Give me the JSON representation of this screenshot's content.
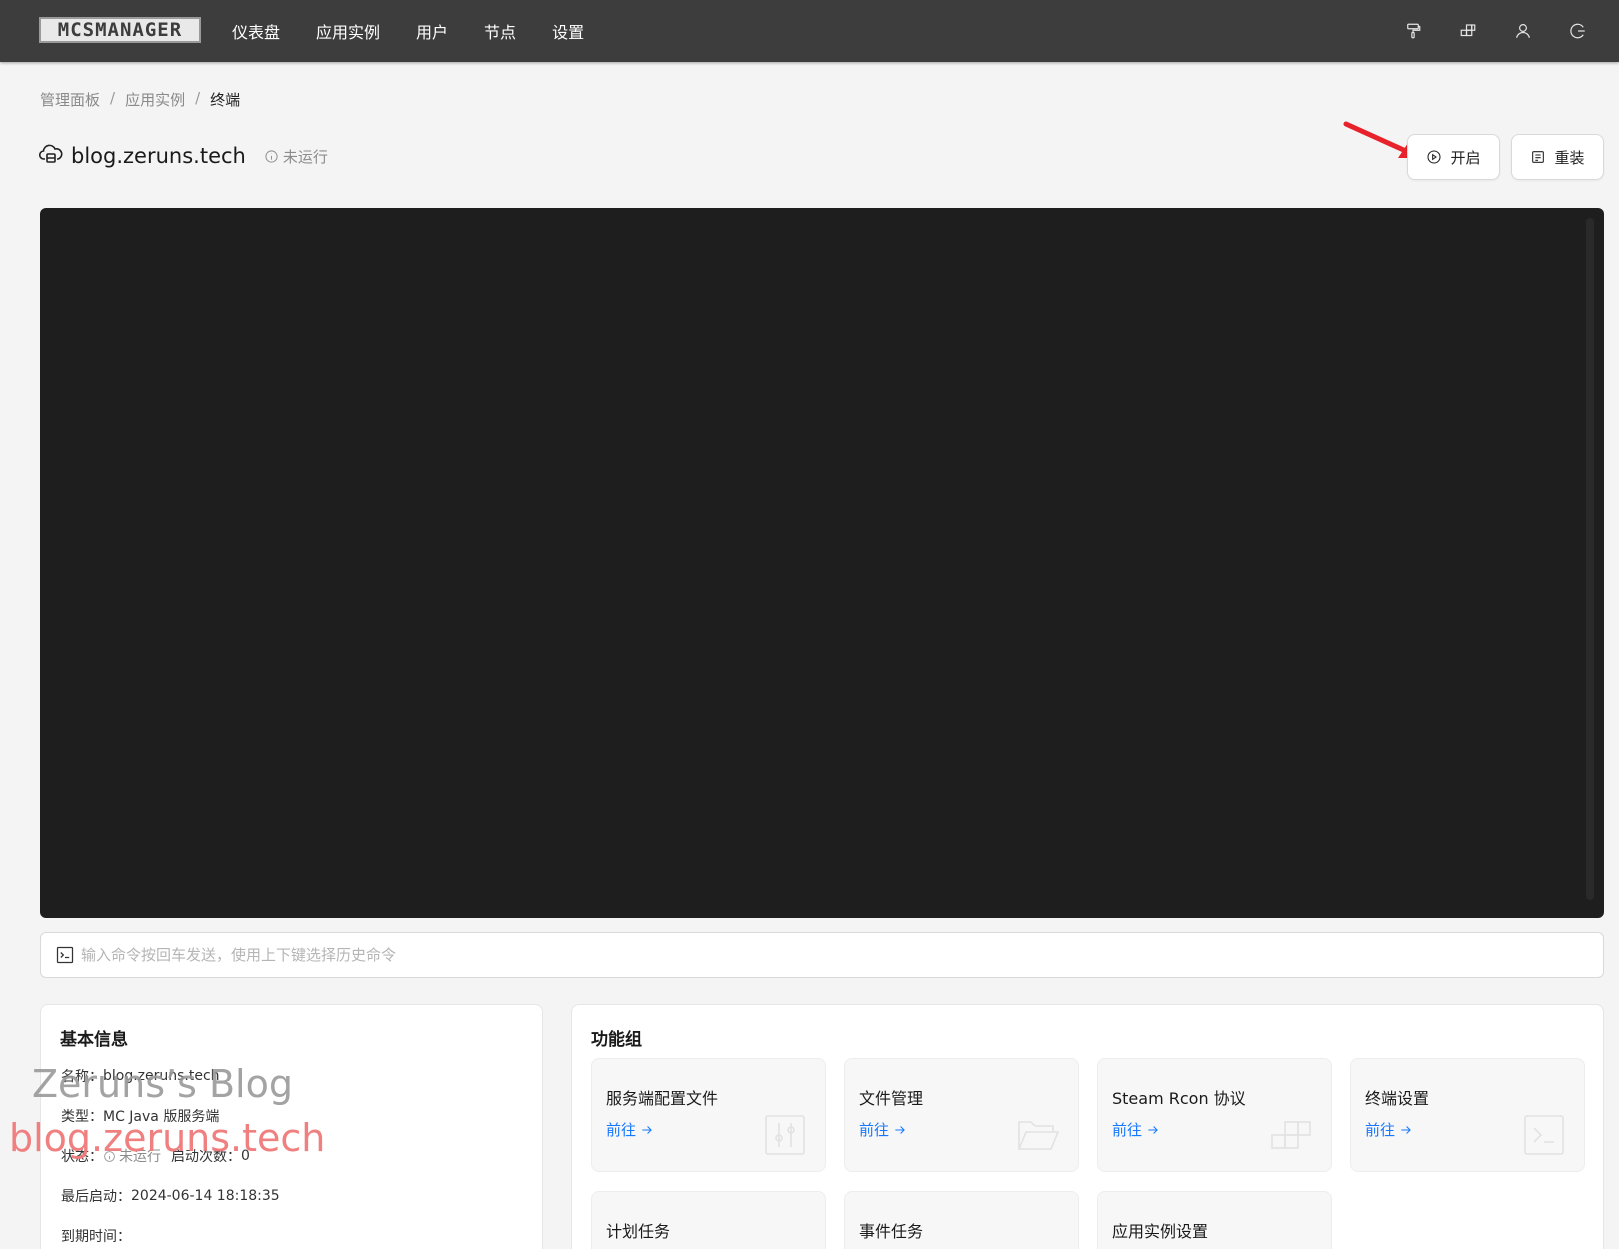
{
  "app": {
    "logo_text": "MCSMANAGER"
  },
  "nav": {
    "items": [
      "仪表盘",
      "应用实例",
      "用户",
      "节点",
      "设置"
    ]
  },
  "top_icons": [
    "paint-roller-icon",
    "nodes-icon",
    "user-icon",
    "logout-icon"
  ],
  "breadcrumb": {
    "items": [
      "管理面板",
      "应用实例",
      "终端"
    ],
    "separator": "/"
  },
  "instance": {
    "name": "blog.zeruns.tech",
    "status": "未运行",
    "start_label": "开启",
    "reinstall_label": "重装"
  },
  "terminal": {
    "input_placeholder": "输入命令按回车发送，使用上下键选择历史命令"
  },
  "basic_info": {
    "title": "基本信息",
    "name_label": "名称：",
    "name_value": "blog.zeruns.tech",
    "type_label": "类型：",
    "type_value": "MC Java 版服务端",
    "status_label": "状态：",
    "status_value": "未运行",
    "start_count_label": "启动次数：",
    "start_count_value": "0",
    "last_start_label": "最后启动：",
    "last_start_value": "2024-06-14 18:18:35",
    "expire_label": "到期时间：",
    "expire_value": ""
  },
  "watermark": {
    "line1": "Zeruns’s Blog",
    "line2": "blog.zeruns.tech"
  },
  "function_group": {
    "title": "功能组",
    "link_label": "前往",
    "items": [
      {
        "name": "服务端配置文件",
        "icon": "sliders-icon"
      },
      {
        "name": "文件管理",
        "icon": "folder-open-icon"
      },
      {
        "name": "Steam Rcon 协议",
        "icon": "blocks-icon"
      },
      {
        "name": "终端设置",
        "icon": "terminal-icon"
      },
      {
        "name": "计划任务",
        "icon": "calendar-icon"
      },
      {
        "name": "事件任务",
        "icon": "event-icon"
      },
      {
        "name": "应用实例设置",
        "icon": "settings-icon"
      }
    ]
  },
  "colors": {
    "topbar": "#3d3d3d",
    "terminal_bg": "#1e1e1e",
    "link": "#1677ff",
    "annotation_arrow": "#e8222a"
  }
}
